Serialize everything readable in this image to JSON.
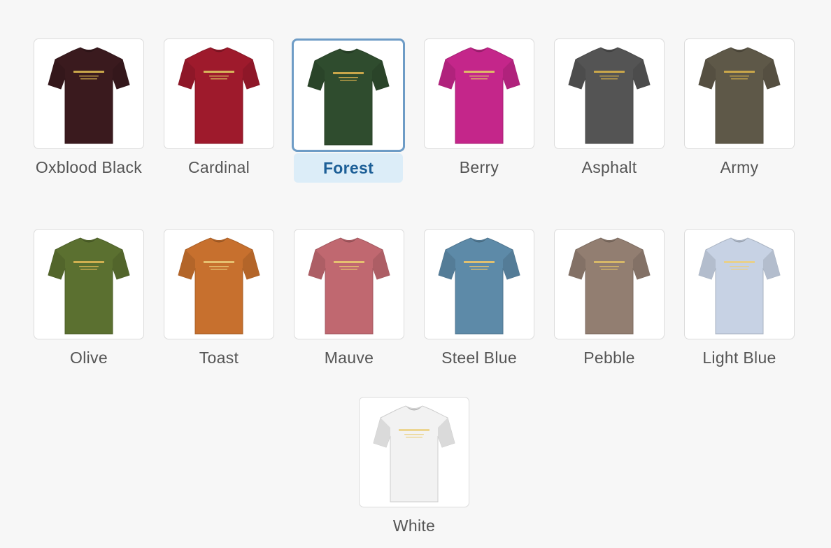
{
  "swatches": [
    {
      "label": "Oxblood Black",
      "color": "#3a1a1e",
      "print": "#c9a64a",
      "selected": false
    },
    {
      "label": "Cardinal",
      "color": "#9e1a2c",
      "print": "#d7b45a",
      "selected": false
    },
    {
      "label": "Forest",
      "color": "#2f4c2e",
      "print": "#c9a64a",
      "selected": true
    },
    {
      "label": "Berry",
      "color": "#c4268a",
      "print": "#e0b868",
      "selected": false
    },
    {
      "label": "Asphalt",
      "color": "#545454",
      "print": "#c9a64a",
      "selected": false
    },
    {
      "label": "Army",
      "color": "#5e5848",
      "print": "#c9a64a",
      "selected": false
    },
    {
      "label": "Olive",
      "color": "#5b7030",
      "print": "#d0b050",
      "selected": false
    },
    {
      "label": "Toast",
      "color": "#c7702e",
      "print": "#e6c070",
      "selected": false
    },
    {
      "label": "Mauve",
      "color": "#c06870",
      "print": "#e6c070",
      "selected": false
    },
    {
      "label": "Steel Blue",
      "color": "#5d8aa8",
      "print": "#e0c070",
      "selected": false
    },
    {
      "label": "Pebble",
      "color": "#927e71",
      "print": "#d7b868",
      "selected": false
    },
    {
      "label": "Light Blue",
      "color": "#c7d2e4",
      "print": "#e8d08a",
      "selected": false
    },
    {
      "label": "White",
      "color": "#f2f2f2",
      "print": "#ecd590",
      "selected": false
    }
  ]
}
